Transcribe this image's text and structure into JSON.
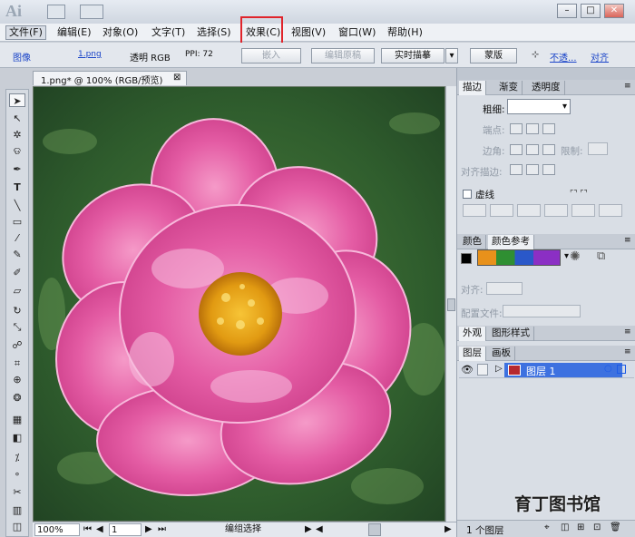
{
  "app": {
    "logo": "Ai"
  },
  "window_controls": {
    "minimize": "–",
    "restore": "□",
    "close": "✕"
  },
  "menu": {
    "file": "文件(F)",
    "edit": "编辑(E)",
    "object": "对象(O)",
    "type": "文字(T)",
    "select": "选择(S)",
    "effect": "效果(C)",
    "view": "视图(V)",
    "window": "窗口(W)",
    "help": "帮助(H)"
  },
  "controlbar": {
    "label": "图像",
    "filename": "1.png",
    "mode": "透明 RGB",
    "ppi": "PPI: 72",
    "embed": "嵌入",
    "edit_original": "编辑原稿",
    "live_trace": "实时描摹",
    "mask": "蒙版",
    "opacity": "不透...",
    "align": "对齐"
  },
  "document": {
    "tab_title": "1.png* @ 100% (RGB/预览)",
    "close": "⊠"
  },
  "statusbar": {
    "zoom": "100%",
    "page": "1",
    "tool_status": "编组选择"
  },
  "stroke_panel": {
    "tabs": [
      "描边",
      "渐变",
      "透明度"
    ],
    "weight_label": "粗细:",
    "cap_label": "端点:",
    "corner_label": "边角:",
    "limit_label": "限制:",
    "align_label": "对齐描边:",
    "dashed_label": "虚线"
  },
  "color_panel": {
    "tabs": [
      "颜色",
      "颜色参考"
    ],
    "align_label": "对齐:",
    "profile_label": "配置文件:"
  },
  "appearance_panel": {
    "tabs": [
      "外观",
      "图形样式"
    ]
  },
  "layers_panel": {
    "tabs": [
      "图层",
      "画板"
    ],
    "layers": [
      {
        "name": "图层 1",
        "color": "#1e5be6"
      }
    ],
    "count": "1 个图层"
  },
  "watermark": "育丁图书馆",
  "colors": {
    "highlight": "#e0242b",
    "canvas": "#2e5a2c"
  }
}
